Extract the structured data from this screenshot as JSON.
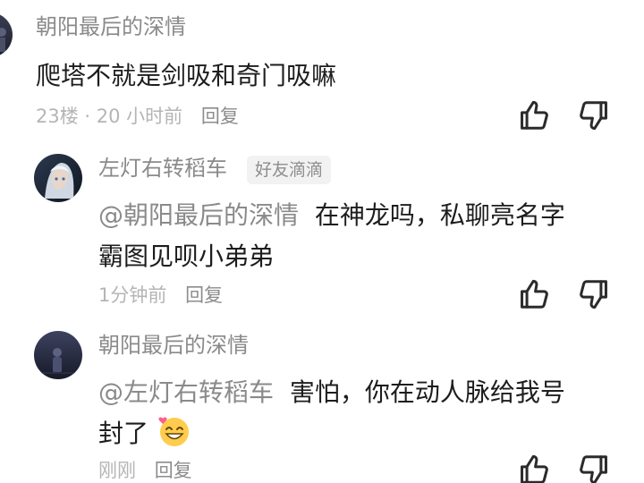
{
  "comments": [
    {
      "user": "朝阳最后的深情",
      "text": "爬塔不就是剑吸和奇门吸嘛",
      "floor": "23楼",
      "separator": " · ",
      "time": "20 小时前",
      "reply_label": "回复"
    },
    {
      "user": "左灯右转稻车",
      "badge": "好友滴滴",
      "mention": "@朝阳最后的深情",
      "text_line1": "在神龙吗，私聊亮名字",
      "text_line2": "霸图见呗小弟弟",
      "time": "1分钟前",
      "reply_label": "回复"
    },
    {
      "user": "朝阳最后的深情",
      "mention": "@左灯右转稻车",
      "text_line1": "害怕，你在动人脉给我号",
      "text_line2": "封了",
      "emoji": "grinning-heart-emoji",
      "time": "刚刚",
      "reply_label": "回复"
    }
  ],
  "icons": {
    "like": "thumbs-up-icon",
    "dislike": "thumbs-down-icon"
  },
  "colors": {
    "username": "#8a8a8a",
    "meta": "#b5b5b5",
    "text": "#1d1d1d",
    "badge_bg": "#f2f2f2"
  }
}
